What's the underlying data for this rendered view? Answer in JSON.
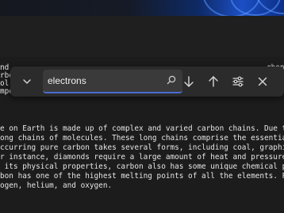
{
  "find": {
    "query": "electrons",
    "search_icon": "search-icon",
    "expand_icon": "chevron-down-icon",
    "prev_icon": "arrow-down-icon",
    "next_icon": "arrow-up-icon",
    "options_icon": "sliders-icon",
    "close_icon": "close-icon"
  },
  "editor": {
    "upper_lines": [
      "nd",
      "rbo",
      "ol",
      "mpo"
    ],
    "right_fragments": [
      "rbon",
      "hem",
      "cov",
      "mpos"
    ],
    "lines": [
      "e on Earth is made up of complex and varied carbon chains. Due to its",
      "ong chains of molecules. These long chains comprise the essential buil",
      "ccurring pure carbon takes several forms, including coal, graphite, an",
      "r instance, diamonds require a large amount of heat and pressure to fo",
      " its physical properties, carbon also has some unique chemical propert",
      "bon has one of the highest melting points of all the elements. Plus, i",
      "ogen, helium, and oxygen."
    ]
  },
  "colors": {
    "accent": "#4a6cd0",
    "background": "#1c1c1c",
    "findbar": "#2b2b2b"
  }
}
